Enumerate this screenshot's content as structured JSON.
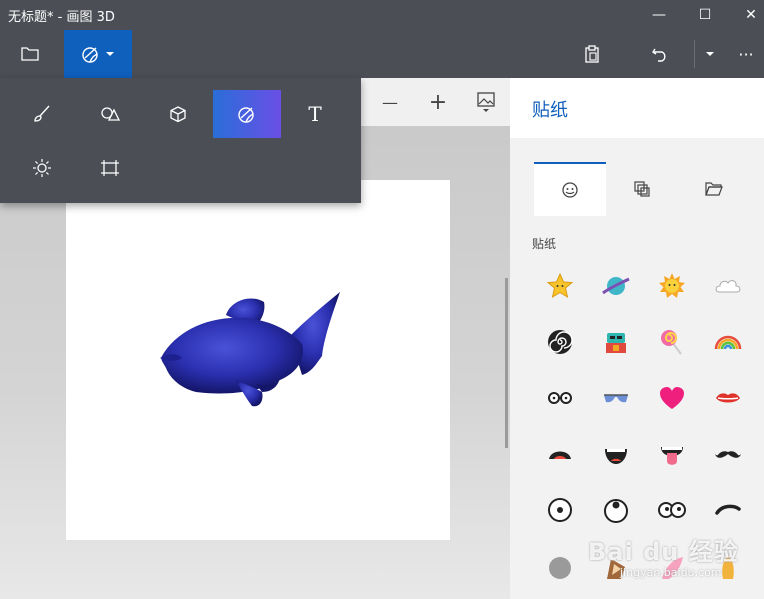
{
  "window": {
    "title": "无标题* - 画图 3D",
    "minimize_glyph": "—",
    "maximize_glyph": "☐",
    "close_glyph": "✕"
  },
  "toolbar": {
    "menu_icon": "folder-icon",
    "active_tool_icon": "sticker-brush-icon",
    "paste_icon": "clipboard-icon",
    "undo_icon": "undo-icon",
    "more_glyph": "···"
  },
  "viewbar": {
    "zoom_out_glyph": "—",
    "zoom_in_glyph": "+",
    "image_icon": "image-icon"
  },
  "flyout": {
    "tools": [
      {
        "name": "brushes-icon"
      },
      {
        "name": "2d-shapes-icon"
      },
      {
        "name": "3d-shapes-icon"
      },
      {
        "name": "stickers-icon",
        "active": true
      },
      {
        "name": "text-icon",
        "glyph": "T"
      },
      {
        "name": "effects-icon"
      },
      {
        "name": "canvas-icon"
      }
    ]
  },
  "panel": {
    "title": "贴纸",
    "tabs": [
      "stickers-tab",
      "textures-tab",
      "custom-tab"
    ],
    "section_label": "贴纸",
    "stickers": [
      "star",
      "planet",
      "sun",
      "cloud",
      "spiral",
      "robot",
      "lollipop",
      "rainbow",
      "glasses",
      "sunglasses",
      "heart",
      "lips",
      "open-mouth",
      "smile-mouth",
      "tongue-mouth",
      "mustache",
      "eye",
      "eye-up",
      "two-eyes",
      "eyebrow",
      "nose",
      "ear-brown",
      "ear-pink",
      "ear-gold"
    ]
  },
  "watermark": {
    "logo": "Bai du 经验",
    "url": "jingyan.baidu.com"
  },
  "colors": {
    "accent": "#0f5fbd",
    "chrome": "#4b4e55",
    "fish": "#2a2fae"
  }
}
